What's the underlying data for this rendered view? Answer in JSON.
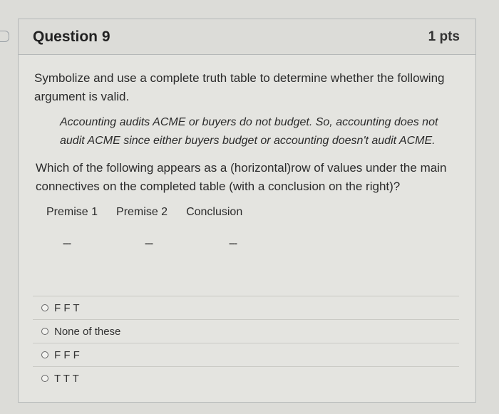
{
  "question": {
    "title": "Question 9",
    "points": "1 pts",
    "prompt": "Symbolize and use a complete truth table to determine whether the following argument is valid.",
    "argument": "Accounting audits ACME or buyers do not budget.  So, accounting does not audit ACME since either buyers budget or accounting doesn't audit ACME.",
    "ask": "Which of the following appears as a (horizontal)row of values under the main connectives on the completed table (with a conclusion on the right)?",
    "columns": [
      "Premise 1",
      "Premise 2",
      "Conclusion"
    ],
    "blanks": [
      "---",
      "---",
      "---"
    ]
  },
  "answers": [
    {
      "label": "F F T",
      "selected": false
    },
    {
      "label": "None of these",
      "selected": false
    },
    {
      "label": "F F F",
      "selected": false
    },
    {
      "label": "T T T",
      "selected": false
    }
  ]
}
